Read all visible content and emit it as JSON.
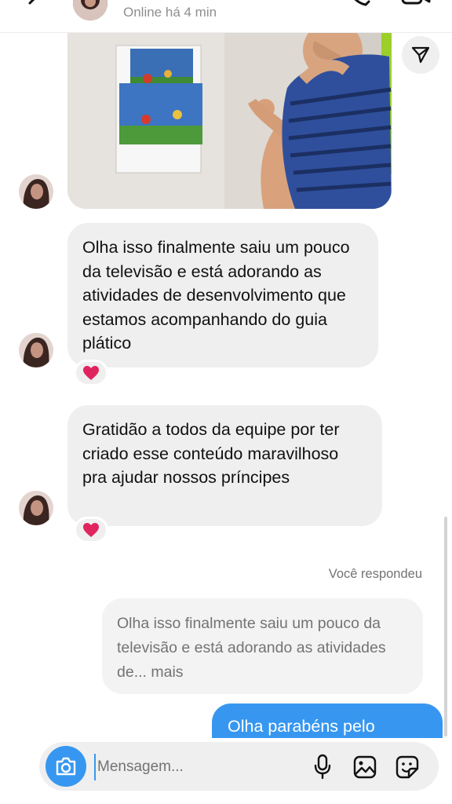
{
  "header": {
    "status": "Online há 4 min",
    "icons": [
      "back-arrow-icon",
      "phone-icon",
      "video-camera-icon"
    ]
  },
  "messages": {
    "share_icon": "paper-plane-icon",
    "received": [
      {
        "text": "Olha isso finalmente saiu um pouco da televisão e está adorando as atividades de desenvolvimento que estamos acompanhando do guia plático",
        "reaction": "❤️"
      },
      {
        "text": "Gratidão a todos da equipe por ter criado esse conteúdo maravilhoso pra ajudar nossos príncipes",
        "reaction": "❤️"
      }
    ],
    "replied_label": "Você respondeu",
    "quoted_text": "Olha isso finalmente saiu um pouco da televisão e está adorando as atividades de... mais",
    "sent_text": "Olha parabéns pelo"
  },
  "composer": {
    "placeholder": "Mensagem...",
    "icons": [
      "camera-icon",
      "microphone-icon",
      "gallery-icon",
      "sticker-icon"
    ]
  },
  "colors": {
    "accent": "#3797f0",
    "bubble_received": "#efefef",
    "muted_text": "#737373",
    "reaction_heart": "#e0245e"
  }
}
